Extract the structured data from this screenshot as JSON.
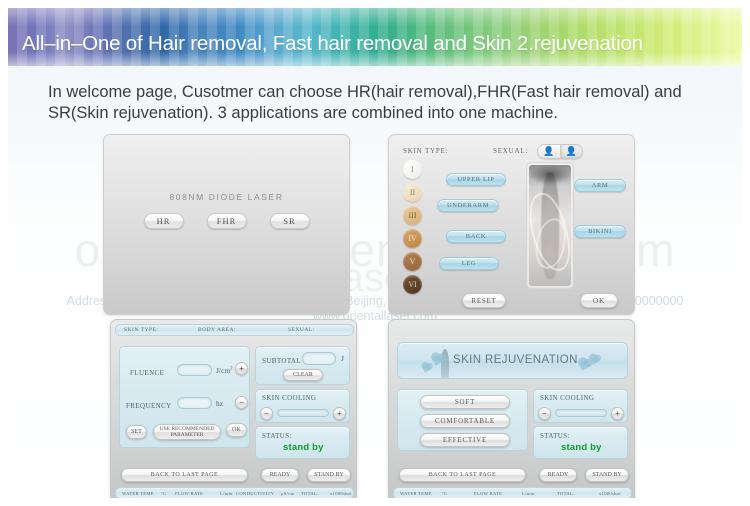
{
  "banner": {
    "title": "All–in–One of Hair removal, Fast hair removal and Skin 2.rejuvenation",
    "gradient_start": "#7c74b4",
    "gradient_end": "#eefaab"
  },
  "description": "In welcome page, Cusotmer can choose HR(hair removal),FHR(Fast hair removal) and SR(Skin rejuvenation). 3 applications are combined into one machine.",
  "watermark": {
    "line1": "orientallaser.en.alibaba.com",
    "line2": "Oriental Laser Co., Ltd.",
    "line3": "Address: 2/F, No.1 Building, Xihonemen Road 20, Beijing, 100000  Tel: 86–10–00000000  Fax: 86–10–00000000  www.orientallaser.com"
  },
  "welcome_panel": {
    "title": "808NM DIODE LASER",
    "modes": [
      "HR",
      "FHR",
      "SR"
    ]
  },
  "select_panel": {
    "skin_type_label": "SKIN TYPE:",
    "sexual_label": "SEXUAL:",
    "sexual_options": [
      "female-icon",
      "male-icon"
    ],
    "sexual_selected_index": 1,
    "skin_types": [
      {
        "numeral": "I",
        "color": "#ebe7e2"
      },
      {
        "numeral": "II",
        "color": "#e4cfa9"
      },
      {
        "numeral": "III",
        "color": "#d2ab75"
      },
      {
        "numeral": "IV",
        "color": "#b9833f"
      },
      {
        "numeral": "V",
        "color": "#93623a"
      },
      {
        "numeral": "VI",
        "color": "#4f3722"
      }
    ],
    "body_areas_left": [
      "UPPER LIP",
      "UNDERARM",
      "BACK",
      "LEG"
    ],
    "body_areas_right": [
      "ARM",
      "BIKINI"
    ],
    "reset_label": "RESET",
    "ok_label": "OK"
  },
  "hr_panel": {
    "top_bar": {
      "skin_type": "SKIN TYPE:",
      "body_area": "BODY AREA:",
      "sexual": "SEXUAL:"
    },
    "fluence_label": "FLUENCE",
    "fluence_value": "",
    "fluence_unit": "J/cm",
    "fluence_unit_sup": "2",
    "frequency_label": "FREQUENCY",
    "frequency_value": "",
    "frequency_unit": "hz",
    "set_label": "SET",
    "recommend_label": "USE  RECOMMENDED PARAMETER",
    "ok_label": "OK",
    "subtotal_label": "SUBTOTAL",
    "subtotal_value": "",
    "subtotal_unit": "J",
    "clear_label": "CLEAR",
    "skin_cooling_label": "SKIN COOLING",
    "cooling_minus": "−",
    "cooling_plus": "+",
    "status_label": "STATUS:",
    "status_value": "stand by",
    "status_color": "#109b2e",
    "back_label": "BACK TO LAST PAGE",
    "ready_label": "READY",
    "standby_label": "STAND BY",
    "footer": {
      "water_temp": "WATER TEMP.",
      "water_temp_unit": "°C",
      "flow_rate": "FLOW RATE",
      "flow_rate_unit": "L/min",
      "conductivity": "CONDUCTIVITY",
      "conductivity_unit": "μS/cm",
      "total": "TOTAL:",
      "total_unit": "x1000shot"
    }
  },
  "sr_panel": {
    "banner_title": "SKIN REJUVENATION",
    "modes": [
      "SOFT",
      "COMFORTABLE",
      "EFFECTIVE"
    ],
    "skin_cooling_label": "SKIN COOLING",
    "cooling_minus": "−",
    "cooling_plus": "+",
    "status_label": "STATUS:",
    "status_value": "stand by",
    "status_color": "#109b2e",
    "back_label": "BACK TO LAST PAGE",
    "ready_label": "READY",
    "standby_label": "STAND BY",
    "footer": {
      "water_temp": "WATER TEMP.",
      "water_temp_unit": "°C",
      "flow_rate": "FLOW RATE",
      "flow_rate_unit": "L/min",
      "total": "TOTAL:",
      "total_unit": "x1000shot"
    }
  }
}
